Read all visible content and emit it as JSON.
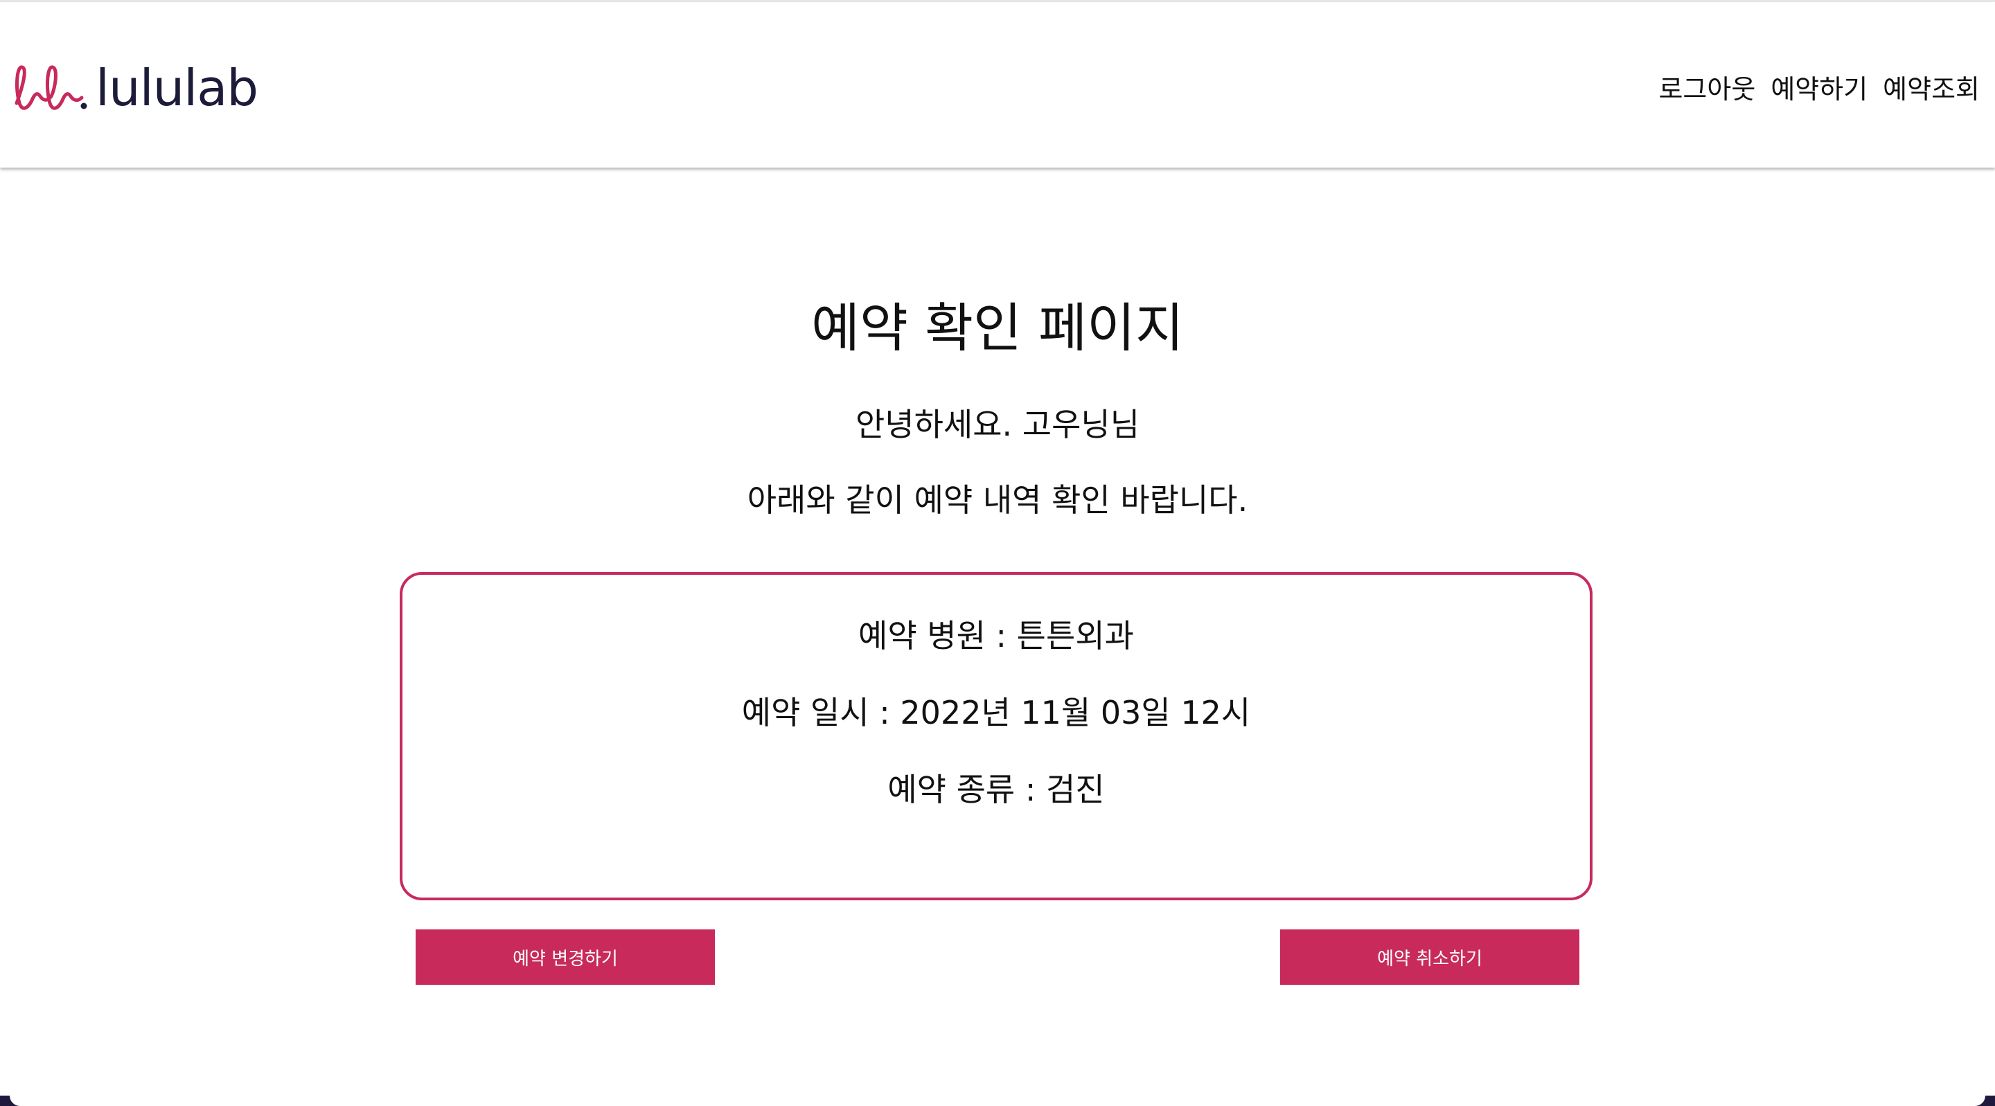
{
  "brand": {
    "logo_mark": "lele",
    "logo_text": "lululab",
    "accent_color": "#c82a5c",
    "logo_text_color": "#1d1b3a"
  },
  "nav": {
    "items": [
      {
        "label": "로그아웃"
      },
      {
        "label": "예약하기"
      },
      {
        "label": "예약조회"
      }
    ]
  },
  "page": {
    "title": "예약 확인 페이지",
    "greeting": "안녕하세요. 고우닝님",
    "instruction": "아래와 같이 예약 내역 확인 바랍니다."
  },
  "reservation": {
    "hospital": "예약 병원 : 튼튼외과",
    "datetime": "예약 일시 : 2022년 11월 03일 12시",
    "type": "예약 종류 : 검진"
  },
  "actions": {
    "change_label": "예약 변경하기",
    "cancel_label": "예약 취소하기"
  }
}
